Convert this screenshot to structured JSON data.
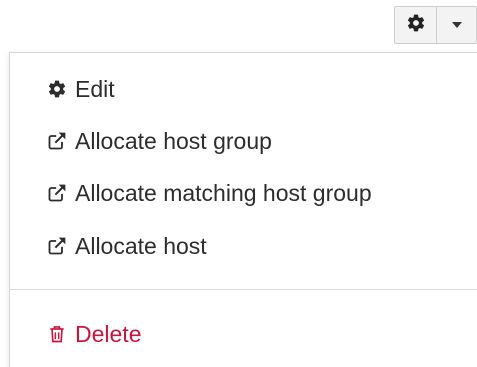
{
  "toolbar": {
    "settings_icon": "gear-icon",
    "dropdown_icon": "caret-down-icon"
  },
  "menu": {
    "items": [
      {
        "label": "Edit",
        "icon": "gear-icon"
      },
      {
        "label": "Allocate host group",
        "icon": "external-link-icon"
      },
      {
        "label": "Allocate matching host group",
        "icon": "external-link-icon"
      },
      {
        "label": "Allocate host",
        "icon": "external-link-icon"
      }
    ],
    "danger_item": {
      "label": "Delete",
      "icon": "trash-icon"
    }
  },
  "colors": {
    "text": "#2d2d2d",
    "danger": "#c6173e",
    "button_bg": "#f3f3f3",
    "border": "#cfcfcf"
  }
}
